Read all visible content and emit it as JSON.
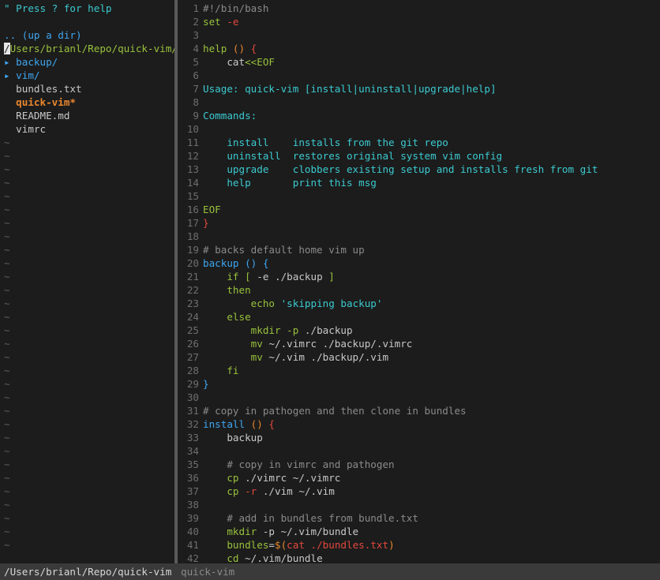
{
  "colors": {
    "background": "#1c1c1c",
    "gutter": "#6e6e6e",
    "plain": "#c8c8c8",
    "comment": "#8a8a8a",
    "keyword_green": "#98c13c",
    "function_blue": "#3fa6f0",
    "string_cyan": "#3ccad0",
    "red": "#e2483d",
    "orange": "#e9872f",
    "tilde": "#5c5c5c",
    "status_bar": "#3a3a3a",
    "cursor": "#e6e6e6",
    "tree_path": "#98c13c",
    "tree_dir": "#3fa6f0",
    "tree_exec": "#e9872f"
  },
  "tree": {
    "help_hint": "\" Press ? for help",
    "up_dir": ".. (up a dir)",
    "cursor_char": "/",
    "current_path_rest": "Users/brianl/Repo/quick-vim/",
    "entries": [
      {
        "marker": "▸ ",
        "name": "backup/",
        "kind": "dir"
      },
      {
        "marker": "▸ ",
        "name": "vim/",
        "kind": "dir"
      },
      {
        "marker": "  ",
        "name": "bundles.txt",
        "kind": "file"
      },
      {
        "marker": "  ",
        "name": "quick-vim*",
        "kind": "exec"
      },
      {
        "marker": "  ",
        "name": "README.md",
        "kind": "file"
      },
      {
        "marker": "  ",
        "name": "vimrc",
        "kind": "file"
      }
    ],
    "tilde": "~",
    "tilde_count": 31
  },
  "editor": {
    "lines": [
      {
        "n": "1",
        "segs": [
          {
            "t": "#!/bin/bash",
            "c": "comment"
          }
        ]
      },
      {
        "n": "2",
        "segs": [
          {
            "t": "set ",
            "c": "keyword_green"
          },
          {
            "t": "-e",
            "c": "red"
          }
        ]
      },
      {
        "n": "3",
        "segs": []
      },
      {
        "n": "4",
        "segs": [
          {
            "t": "help ",
            "c": "keyword_green"
          },
          {
            "t": "()",
            "c": "orange"
          },
          {
            "t": " {",
            "c": "red"
          }
        ]
      },
      {
        "n": "5",
        "segs": [
          {
            "t": "    cat",
            "c": "plain"
          },
          {
            "t": "<<EOF",
            "c": "keyword_green"
          }
        ]
      },
      {
        "n": "6",
        "segs": []
      },
      {
        "n": "7",
        "segs": [
          {
            "t": "Usage: quick-vim [install|uninstall|upgrade|help]",
            "c": "string_cyan"
          }
        ]
      },
      {
        "n": "8",
        "segs": []
      },
      {
        "n": "9",
        "segs": [
          {
            "t": "Commands:",
            "c": "string_cyan"
          }
        ]
      },
      {
        "n": "10",
        "segs": []
      },
      {
        "n": "11",
        "segs": [
          {
            "t": "    install    installs from the git repo",
            "c": "string_cyan"
          }
        ]
      },
      {
        "n": "12",
        "segs": [
          {
            "t": "    uninstall  restores original system vim config",
            "c": "string_cyan"
          }
        ]
      },
      {
        "n": "13",
        "segs": [
          {
            "t": "    upgrade    clobbers existing setup and installs fresh from git",
            "c": "string_cyan"
          }
        ]
      },
      {
        "n": "14",
        "segs": [
          {
            "t": "    help       print this msg",
            "c": "string_cyan"
          }
        ]
      },
      {
        "n": "15",
        "segs": []
      },
      {
        "n": "16",
        "segs": [
          {
            "t": "EOF",
            "c": "keyword_green"
          }
        ]
      },
      {
        "n": "17",
        "segs": [
          {
            "t": "}",
            "c": "red"
          }
        ]
      },
      {
        "n": "18",
        "segs": []
      },
      {
        "n": "19",
        "segs": [
          {
            "t": "# backs default home vim up",
            "c": "comment"
          }
        ]
      },
      {
        "n": "20",
        "segs": [
          {
            "t": "backup ",
            "c": "function_blue"
          },
          {
            "t": "()",
            "c": "function_blue"
          },
          {
            "t": " {",
            "c": "function_blue"
          }
        ]
      },
      {
        "n": "21",
        "segs": [
          {
            "t": "    if",
            "c": "keyword_green"
          },
          {
            "t": " [ ",
            "c": "keyword_green"
          },
          {
            "t": "-e ./backup",
            "c": "plain"
          },
          {
            "t": " ]",
            "c": "keyword_green"
          }
        ]
      },
      {
        "n": "22",
        "segs": [
          {
            "t": "    then",
            "c": "keyword_green"
          }
        ]
      },
      {
        "n": "23",
        "segs": [
          {
            "t": "        echo ",
            "c": "keyword_green"
          },
          {
            "t": "'skipping backup'",
            "c": "string_cyan"
          }
        ]
      },
      {
        "n": "24",
        "segs": [
          {
            "t": "    else",
            "c": "keyword_green"
          }
        ]
      },
      {
        "n": "25",
        "segs": [
          {
            "t": "        mkdir ",
            "c": "keyword_green"
          },
          {
            "t": "-p",
            "c": "keyword_green"
          },
          {
            "t": " ./backup",
            "c": "plain"
          }
        ]
      },
      {
        "n": "26",
        "segs": [
          {
            "t": "        mv ",
            "c": "keyword_green"
          },
          {
            "t": "~/.vimrc ./backup/.vimrc",
            "c": "plain"
          }
        ]
      },
      {
        "n": "27",
        "segs": [
          {
            "t": "        mv ",
            "c": "keyword_green"
          },
          {
            "t": "~/.vim ./backup/.vim",
            "c": "plain"
          }
        ]
      },
      {
        "n": "28",
        "segs": [
          {
            "t": "    fi",
            "c": "keyword_green"
          }
        ]
      },
      {
        "n": "29",
        "segs": [
          {
            "t": "}",
            "c": "function_blue"
          }
        ]
      },
      {
        "n": "30",
        "segs": []
      },
      {
        "n": "31",
        "segs": [
          {
            "t": "# copy in pathogen and then clone in bundles",
            "c": "comment"
          }
        ]
      },
      {
        "n": "32",
        "segs": [
          {
            "t": "install ",
            "c": "function_blue"
          },
          {
            "t": "()",
            "c": "orange"
          },
          {
            "t": " {",
            "c": "red"
          }
        ]
      },
      {
        "n": "33",
        "segs": [
          {
            "t": "    backup",
            "c": "plain"
          }
        ]
      },
      {
        "n": "34",
        "segs": []
      },
      {
        "n": "35",
        "segs": [
          {
            "t": "    # copy in vimrc and pathogen",
            "c": "comment"
          }
        ]
      },
      {
        "n": "36",
        "segs": [
          {
            "t": "    cp ",
            "c": "keyword_green"
          },
          {
            "t": "./vimrc ~/.vimrc",
            "c": "plain"
          }
        ]
      },
      {
        "n": "37",
        "segs": [
          {
            "t": "    cp ",
            "c": "keyword_green"
          },
          {
            "t": "-r",
            "c": "red"
          },
          {
            "t": " ./vim ~/.vim",
            "c": "plain"
          }
        ]
      },
      {
        "n": "38",
        "segs": []
      },
      {
        "n": "39",
        "segs": [
          {
            "t": "    # add in bundles from bundle.txt",
            "c": "comment"
          }
        ]
      },
      {
        "n": "40",
        "segs": [
          {
            "t": "    mkdir ",
            "c": "keyword_green"
          },
          {
            "t": "-p ~/.vim/bundle",
            "c": "plain"
          }
        ]
      },
      {
        "n": "41",
        "segs": [
          {
            "t": "    bundles",
            "c": "keyword_green"
          },
          {
            "t": "=",
            "c": "plain"
          },
          {
            "t": "$(",
            "c": "orange"
          },
          {
            "t": "cat ./bundles.txt",
            "c": "red"
          },
          {
            "t": ")",
            "c": "orange"
          }
        ]
      },
      {
        "n": "42",
        "segs": [
          {
            "t": "    cd ",
            "c": "keyword_green"
          },
          {
            "t": "~/.vim/bundle",
            "c": "plain"
          }
        ]
      }
    ]
  },
  "statusbar": {
    "left": "/Users/brianl/Repo/quick-vim",
    "right": "quick-vim"
  }
}
